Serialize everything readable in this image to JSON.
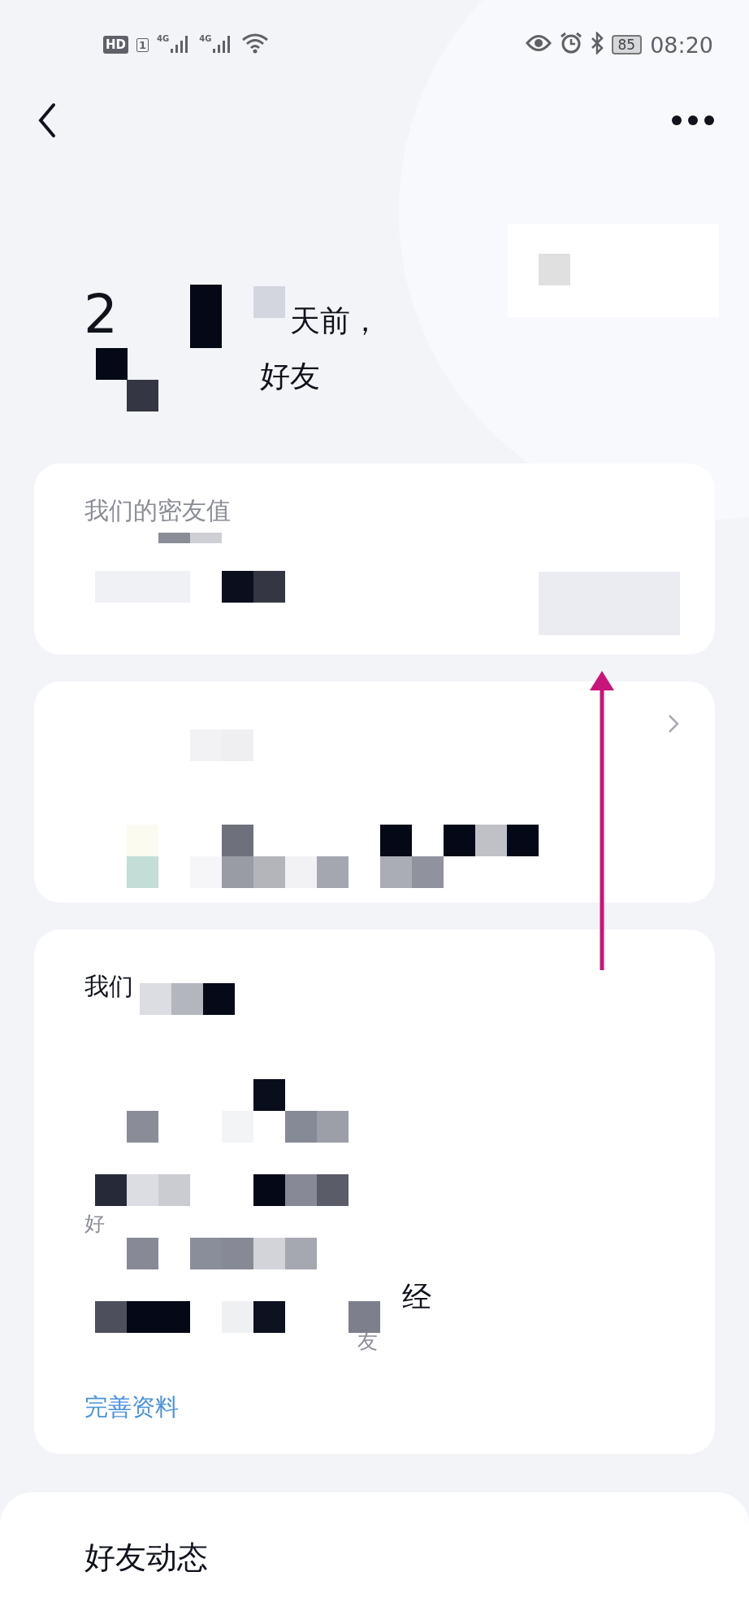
{
  "status_bar": {
    "hd_label": "HD",
    "sim_label": "1",
    "signals": [
      {
        "label": "4G"
      },
      {
        "label": "4G"
      }
    ],
    "battery": "85",
    "time": "08:20"
  },
  "header": {
    "line_1_start": "2",
    "line_1_end": "天前，",
    "line_2_end": "好友"
  },
  "cards": [
    {
      "kind": "value",
      "title": "我们的密友值"
    },
    {
      "kind": "link"
    },
    {
      "kind": "profile",
      "title": "我们",
      "fragments": [
        {
          "text": "好",
          "muted": true
        },
        {
          "text": "经",
          "muted": false
        },
        {
          "text": "友",
          "muted": true
        }
      ],
      "action": "完善资料"
    }
  ],
  "feed_sheet": {
    "title": "好友动态"
  },
  "annotation": {
    "kind": "arrow"
  }
}
